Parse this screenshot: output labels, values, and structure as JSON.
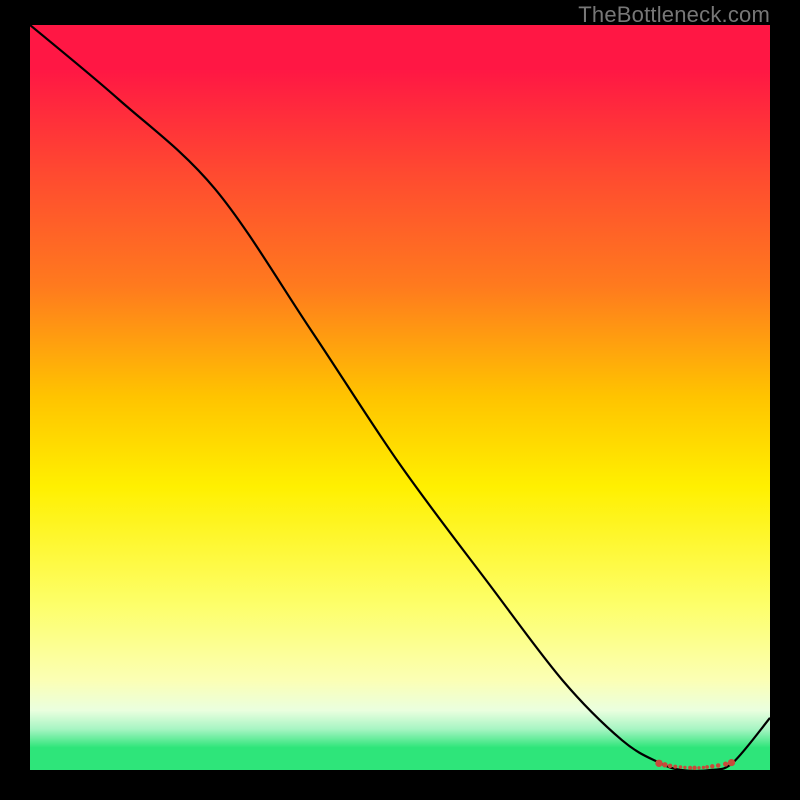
{
  "watermark": "TheBottleneck.com",
  "chart_data": {
    "type": "line",
    "title": "",
    "xlabel": "",
    "ylabel": "",
    "xlim": [
      0,
      100
    ],
    "ylim": [
      0,
      100
    ],
    "grid": false,
    "legend": false,
    "gradient_stops": [
      {
        "offset": 0.0,
        "color": "#ff1744"
      },
      {
        "offset": 0.06,
        "color": "#ff1744"
      },
      {
        "offset": 0.2,
        "color": "#ff4a30"
      },
      {
        "offset": 0.35,
        "color": "#ff7a1e"
      },
      {
        "offset": 0.5,
        "color": "#ffc400"
      },
      {
        "offset": 0.62,
        "color": "#fff000"
      },
      {
        "offset": 0.78,
        "color": "#fdff6b"
      },
      {
        "offset": 0.88,
        "color": "#fbffb5"
      },
      {
        "offset": 0.92,
        "color": "#eaffdf"
      },
      {
        "offset": 0.945,
        "color": "#a7f5c3"
      },
      {
        "offset": 0.97,
        "color": "#2ee57a"
      },
      {
        "offset": 1.0,
        "color": "#2ee57a"
      }
    ],
    "series": [
      {
        "name": "curve",
        "x": [
          0,
          12,
          25,
          38,
          50,
          62,
          72,
          80,
          85,
          88,
          92,
          95,
          100
        ],
        "y": [
          100,
          90,
          78,
          59,
          41,
          25,
          12,
          4,
          1,
          0,
          0,
          1,
          7
        ]
      }
    ],
    "markers": {
      "name": "bottom-cluster",
      "color": "#c84a3a",
      "x": [
        85.0,
        85.8,
        86.5,
        87.2,
        87.9,
        88.5,
        89.2,
        89.8,
        90.4,
        91.0,
        91.5,
        92.2,
        93.0,
        94.0,
        94.8
      ],
      "y": [
        0.9,
        0.7,
        0.55,
        0.45,
        0.4,
        0.35,
        0.3,
        0.3,
        0.3,
        0.35,
        0.4,
        0.5,
        0.6,
        0.8,
        1.0
      ],
      "r": [
        3.7,
        2.7,
        2.3,
        2.0,
        1.8,
        1.7,
        2.0,
        2.2,
        1.7,
        1.7,
        1.9,
        2.2,
        2.3,
        2.6,
        3.6
      ]
    }
  }
}
